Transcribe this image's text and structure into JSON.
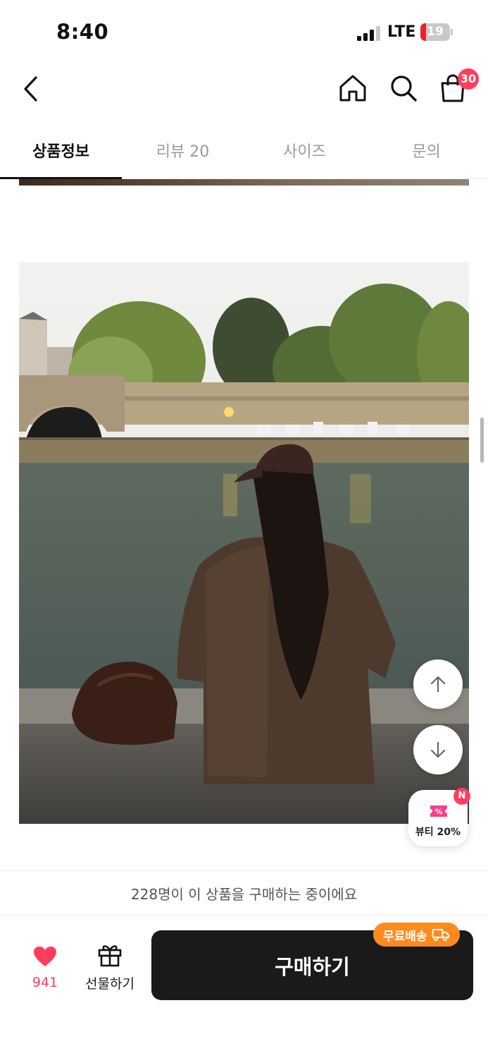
{
  "status_bar": {
    "time": "8:40",
    "network": "LTE",
    "battery_level": 19,
    "battery_text": "19",
    "battery_color": "#e5242b"
  },
  "header": {
    "back_icon": "chevron-left-icon",
    "home_icon": "home-icon",
    "search_icon": "search-icon",
    "cart_icon": "shopping-bag-icon",
    "cart_badge": "30",
    "badge_color": "#ff3d5f"
  },
  "tabs": [
    {
      "label": "상품정보",
      "active": true
    },
    {
      "label": "리뷰 20",
      "active": false
    },
    {
      "label": "사이즈",
      "active": false
    },
    {
      "label": "문의",
      "active": false
    }
  ],
  "floating": {
    "scroll_up_icon": "arrow-up-icon",
    "scroll_down_icon": "arrow-down-icon",
    "beauty_label": "뷰티 20%",
    "beauty_badge": "N",
    "beauty_icon": "coupon-icon",
    "beauty_icon_color": "#ff3d8c"
  },
  "buying_notice": "228명이 이 상품을 구매하는 중이에요",
  "bottom_bar": {
    "like_count": "941",
    "like_icon": "heart-icon",
    "like_color": "#ff3d5f",
    "gift_label": "선물하기",
    "gift_icon": "gift-icon",
    "buy_label": "구매하기",
    "shipping_badge": "무료배송",
    "shipping_icon": "truck-icon",
    "shipping_color": "#ff8a1f"
  }
}
